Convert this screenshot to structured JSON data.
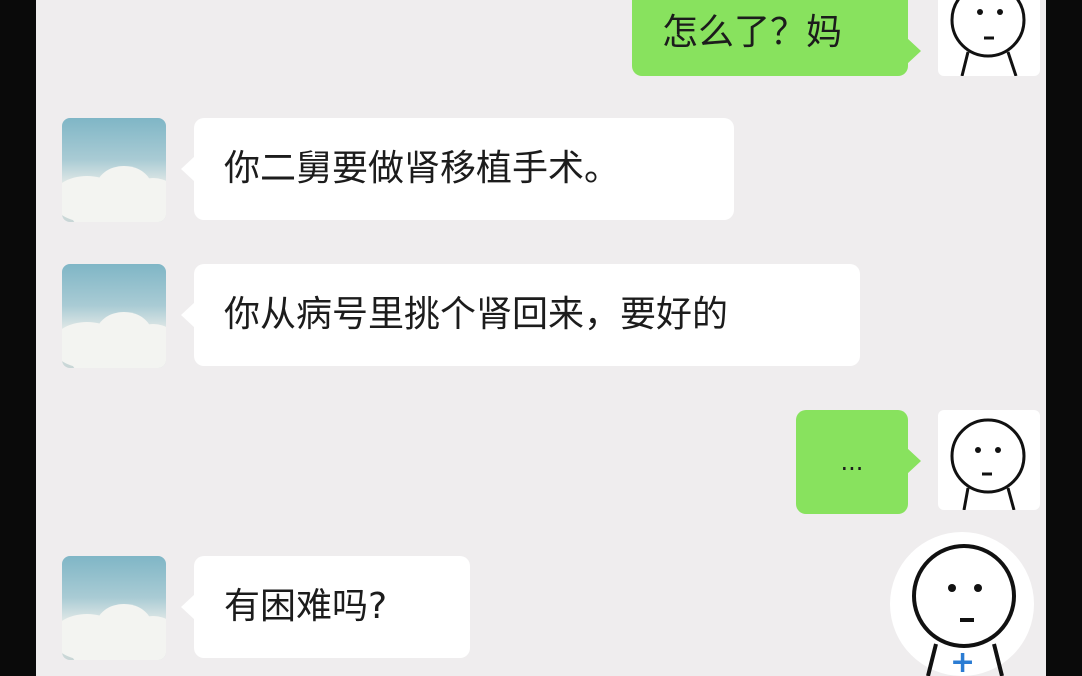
{
  "chat": {
    "messages": [
      {
        "side": "right",
        "text": "怎么了？妈",
        "avatar": "stick-face-icon"
      },
      {
        "side": "left",
        "text": "你二舅要做肾移植手术。",
        "avatar": "sky-cloud-avatar"
      },
      {
        "side": "left",
        "text": "你从病号里挑个肾回来，要好的",
        "avatar": "sky-cloud-avatar"
      },
      {
        "side": "right",
        "text": "...",
        "avatar": "stick-face-icon"
      },
      {
        "side": "left",
        "text": "有困难吗?",
        "avatar": "sky-cloud-avatar"
      }
    ],
    "floating_sticker": {
      "icon": "stick-face-plus-icon",
      "badge": "+"
    }
  },
  "colors": {
    "background": "#efedee",
    "bubble_self": "#88e25e",
    "bubble_other": "#ffffff",
    "text": "#1c1c1c"
  }
}
